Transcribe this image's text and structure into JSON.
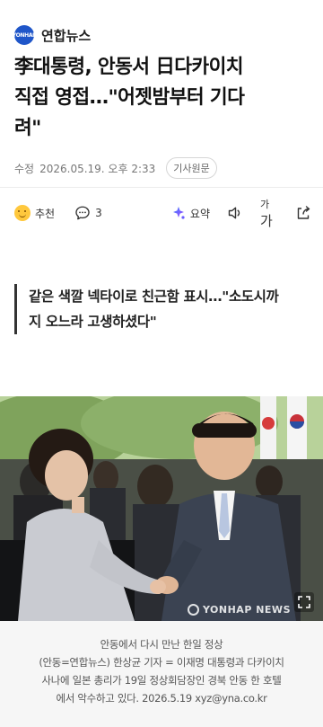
{
  "press": {
    "logo_text": "YONHAP",
    "name": "연합뉴스",
    "brand_color": "#1f56c9"
  },
  "article": {
    "headline_lines": [
      "李대통령, 안동서 日다카이치",
      "직접 영접…\"어젯밤부터 기다",
      "려\""
    ],
    "meta": {
      "label": "수정",
      "date": "2026.05.19. 오후 2:33",
      "original_link": "기사원문"
    },
    "toolbar": {
      "like_label": "추천",
      "like_icon": "smile-emoji-icon",
      "comment_count": "3",
      "comment_icon": "speech-bubble-icon",
      "summary_label": "요약",
      "summary_icon": "sparkle-icon",
      "tts_icon": "speaker-icon",
      "font_size_icon": "font-size-icon",
      "share_icon": "share-icon"
    },
    "subhead_lines": [
      "같은 색깔 넥타이로 친근함 표시…\"소도시까",
      "지 오느라 고생하셨다\""
    ],
    "photo": {
      "watermark": "YONHAP NEWS",
      "expand_icon": "expand-icon"
    },
    "caption_lines": [
      "안동에서 다시 만난 한일 정상",
      "(안동=연합뉴스) 한상균 기자 = 이재명 대통령과 다카이치",
      "사나에 일본 총리가 19일 정상회담장인 경북 안동 한 호텔",
      "에서 악수하고 있다. 2026.5.19 xyz@yna.co.kr"
    ]
  }
}
